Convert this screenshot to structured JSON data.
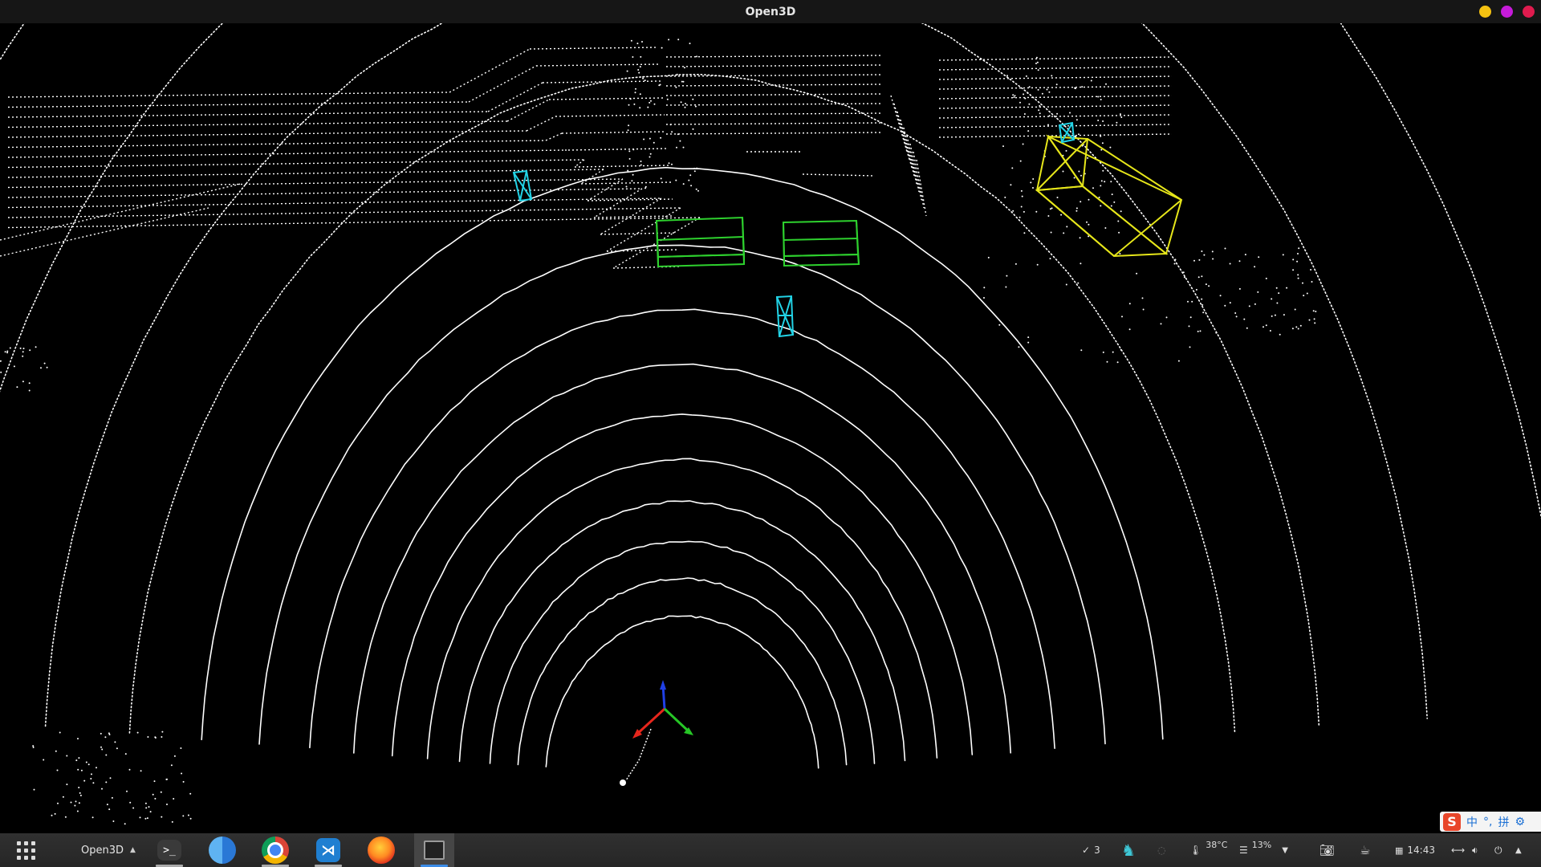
{
  "window": {
    "title": "Open3D",
    "controls": [
      {
        "name": "minimize",
        "color": "#f5c211"
      },
      {
        "name": "maximize",
        "color": "#c61bd9"
      },
      {
        "name": "close",
        "color": "#e01b4e"
      }
    ]
  },
  "scene": {
    "background": "#000000",
    "point_color": "#ffffff",
    "boxes": [
      {
        "label": "car",
        "color": "#2ed12e"
      },
      {
        "label": "car",
        "color": "#2ed12e"
      },
      {
        "label": "truck",
        "color": "#e6e61a"
      },
      {
        "label": "pedestrian",
        "color": "#22d3e6"
      },
      {
        "label": "pedestrian",
        "color": "#22d3e6"
      },
      {
        "label": "pedestrian",
        "color": "#22d3e6"
      }
    ],
    "axes": {
      "x_color": "#e6261c",
      "y_color": "#26c626",
      "z_color": "#2040e6"
    }
  },
  "ime": {
    "logo": "S",
    "mode": "中",
    "punct": "°,",
    "input_method": "拼",
    "settings_icon": "gear-icon"
  },
  "taskbar": {
    "launcher_icon": "app-grid-icon",
    "active_app": "Open3D",
    "dock": [
      {
        "name": "terminal",
        "icon": "terminal-icon"
      },
      {
        "name": "finder",
        "icon": "finder-icon"
      },
      {
        "name": "chrome",
        "icon": "chrome-icon"
      },
      {
        "name": "vscode",
        "icon": "vscode-icon"
      },
      {
        "name": "firefox",
        "icon": "firefox-icon"
      },
      {
        "name": "open3d-window",
        "icon": "window-icon"
      }
    ],
    "tray": {
      "updates_count": "3",
      "temperature": "38°C",
      "usage_percent": "13%",
      "clock": "14:43"
    }
  }
}
